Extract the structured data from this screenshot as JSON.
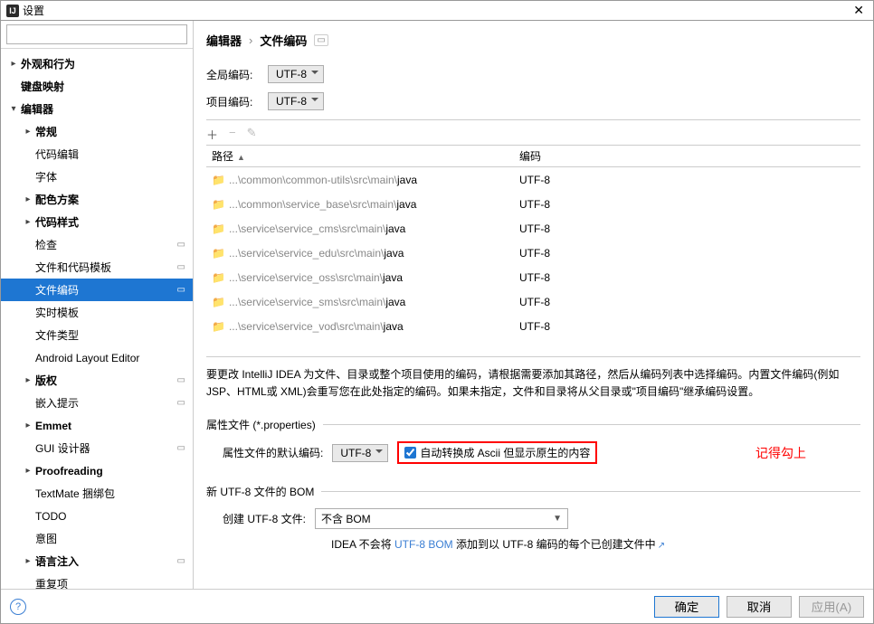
{
  "window": {
    "title": "设置"
  },
  "search": {
    "placeholder": ""
  },
  "sidebar": {
    "items": [
      {
        "label": "外观和行为",
        "bold": true,
        "arrow": ">",
        "depth": 0
      },
      {
        "label": "键盘映射",
        "bold": true,
        "arrow": "",
        "depth": 0
      },
      {
        "label": "编辑器",
        "bold": true,
        "arrow": "v",
        "depth": 0
      },
      {
        "label": "常规",
        "bold": true,
        "arrow": ">",
        "depth": 1
      },
      {
        "label": "代码编辑",
        "bold": false,
        "arrow": "",
        "depth": 1
      },
      {
        "label": "字体",
        "bold": false,
        "arrow": "",
        "depth": 1
      },
      {
        "label": "配色方案",
        "bold": true,
        "arrow": ">",
        "depth": 1
      },
      {
        "label": "代码样式",
        "bold": true,
        "arrow": ">",
        "depth": 1
      },
      {
        "label": "检查",
        "bold": false,
        "arrow": "",
        "depth": 1,
        "trail": true
      },
      {
        "label": "文件和代码模板",
        "bold": false,
        "arrow": "",
        "depth": 1,
        "trail": true
      },
      {
        "label": "文件编码",
        "bold": false,
        "arrow": "",
        "depth": 1,
        "trail": true,
        "selected": true
      },
      {
        "label": "实时模板",
        "bold": false,
        "arrow": "",
        "depth": 1
      },
      {
        "label": "文件类型",
        "bold": false,
        "arrow": "",
        "depth": 1
      },
      {
        "label": "Android Layout Editor",
        "bold": false,
        "arrow": "",
        "depth": 1
      },
      {
        "label": "版权",
        "bold": true,
        "arrow": ">",
        "depth": 1,
        "trail": true
      },
      {
        "label": "嵌入提示",
        "bold": false,
        "arrow": "",
        "depth": 1,
        "trail": true
      },
      {
        "label": "Emmet",
        "bold": true,
        "arrow": ">",
        "depth": 1
      },
      {
        "label": "GUI 设计器",
        "bold": false,
        "arrow": "",
        "depth": 1,
        "trail": true
      },
      {
        "label": "Proofreading",
        "bold": true,
        "arrow": ">",
        "depth": 1
      },
      {
        "label": "TextMate 捆绑包",
        "bold": false,
        "arrow": "",
        "depth": 1
      },
      {
        "label": "TODO",
        "bold": false,
        "arrow": "",
        "depth": 1
      },
      {
        "label": "意图",
        "bold": false,
        "arrow": "",
        "depth": 1
      },
      {
        "label": "语言注入",
        "bold": true,
        "arrow": ">",
        "depth": 1,
        "trail": true
      },
      {
        "label": "重复项",
        "bold": false,
        "arrow": "",
        "depth": 1
      }
    ]
  },
  "breadcrumb": {
    "a": "编辑器",
    "b": "文件编码",
    "sep": "›"
  },
  "topSection": {
    "globalLabel": "全局编码:",
    "globalValue": "UTF-8",
    "projectLabel": "项目编码:",
    "projectValue": "UTF-8"
  },
  "table": {
    "pathHeader": "路径",
    "encHeader": "编码",
    "rows": [
      {
        "gray": "...\\common\\common-utils\\src\\main\\",
        "bold": "java",
        "enc": "UTF-8"
      },
      {
        "gray": "...\\common\\service_base\\src\\main\\",
        "bold": "java",
        "enc": "UTF-8"
      },
      {
        "gray": "...\\service\\service_cms\\src\\main\\",
        "bold": "java",
        "enc": "UTF-8"
      },
      {
        "gray": "...\\service\\service_edu\\src\\main\\",
        "bold": "java",
        "enc": "UTF-8"
      },
      {
        "gray": "...\\service\\service_oss\\src\\main\\",
        "bold": "java",
        "enc": "UTF-8"
      },
      {
        "gray": "...\\service\\service_sms\\src\\main\\",
        "bold": "java",
        "enc": "UTF-8"
      },
      {
        "gray": "...\\service\\service_vod\\src\\main\\",
        "bold": "java",
        "enc": "UTF-8"
      }
    ]
  },
  "hint": "要更改 IntelliJ IDEA 为文件、目录或整个项目使用的编码，请根据需要添加其路径，然后从编码列表中选择编码。内置文件编码(例如JSP、HTML或 XML)会重写您在此处指定的编码。如果未指定，文件和目录将从父目录或\"项目编码\"继承编码设置。",
  "propSection": {
    "legend": "属性文件 (*.properties)",
    "defEncLabel": "属性文件的默认编码:",
    "defEncValue": "UTF-8",
    "checkboxLabel": "自动转换成 Ascii 但显示原生的内容",
    "annotation": "记得勾上"
  },
  "bomSection": {
    "legend": "新 UTF-8 文件的 BOM",
    "createLabel": "创建 UTF-8 文件:",
    "createValue": "不含 BOM",
    "hintPre": "IDEA 不会将 ",
    "hintLink": "UTF-8 BOM",
    "hintPost": " 添加到以 UTF-8 编码的每个已创建文件中"
  },
  "footer": {
    "ok": "确定",
    "cancel": "取消",
    "apply": "应用(A)"
  },
  "icons": {
    "add": "＋",
    "remove": "−",
    "edit": "✎"
  }
}
